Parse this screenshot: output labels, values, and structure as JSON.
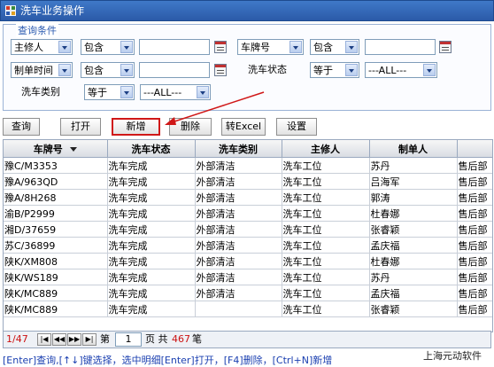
{
  "window": {
    "title": "洗车业务操作"
  },
  "query": {
    "legend": "查询条件",
    "row1": {
      "field1": "主修人",
      "op1": "包含",
      "value1": "",
      "field2": "车牌号",
      "op2": "包含",
      "value2": ""
    },
    "row2": {
      "field1": "制单时间",
      "op1": "包含",
      "value1": "",
      "status_label": "洗车状态",
      "status_op": "等于",
      "status_value": "---ALL---"
    },
    "row3": {
      "type_label": "洗车类别",
      "type_op": "等于",
      "type_value": "---ALL---"
    }
  },
  "toolbar": {
    "query": "查询",
    "open": "打开",
    "add": "新增",
    "delete": "删除",
    "export": "转Excel",
    "settings": "设置"
  },
  "table": {
    "columns": [
      "车牌号",
      "洗车状态",
      "洗车类别",
      "主修人",
      "制单人",
      ""
    ],
    "rows": [
      [
        "豫C/M3353",
        "洗车完成",
        "外部清洁",
        "洗车工位",
        "苏丹",
        "售后部"
      ],
      [
        "豫A/963QD",
        "洗车完成",
        "外部清洁",
        "洗车工位",
        "吕海军",
        "售后部"
      ],
      [
        "豫A/8H268",
        "洗车完成",
        "外部清洁",
        "洗车工位",
        "郭涛",
        "售后部"
      ],
      [
        "渝B/P2999",
        "洗车完成",
        "外部清洁",
        "洗车工位",
        "杜春娜",
        "售后部"
      ],
      [
        "湘D/37659",
        "洗车完成",
        "外部清洁",
        "洗车工位",
        "张睿颖",
        "售后部"
      ],
      [
        "苏C/36899",
        "洗车完成",
        "外部清洁",
        "洗车工位",
        "孟庆福",
        "售后部"
      ],
      [
        "陕K/XM808",
        "洗车完成",
        "外部清洁",
        "洗车工位",
        "杜春娜",
        "售后部"
      ],
      [
        "陕K/WS189",
        "洗车完成",
        "外部清洁",
        "洗车工位",
        "苏丹",
        "售后部"
      ],
      [
        "陕K/MC889",
        "洗车完成",
        "外部清洁",
        "洗车工位",
        "孟庆福",
        "售后部"
      ],
      [
        "陕K/MC889",
        "洗车完成",
        "",
        "洗车工位",
        "张睿颖",
        "售后部"
      ]
    ]
  },
  "pager": {
    "page_info": "1/47",
    "page_prefix": "第",
    "page_value": "1",
    "page_mid": "页 共",
    "total": "467",
    "total_suffix": "笔"
  },
  "footer": {
    "hint": "[Enter]查询,[↑↓]键选择，选中明细[Enter]打开，[F4]删除，[Ctrl+N]新增",
    "brand": "上海元动软件"
  },
  "colors": {
    "title_bar": "#2f64b5",
    "highlight_border": "#d01818",
    "pager_red": "#cc1111"
  }
}
